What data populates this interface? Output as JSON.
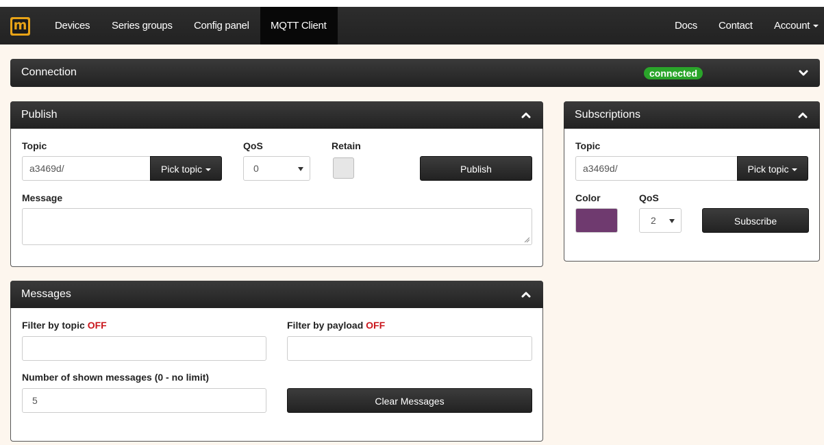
{
  "nav": {
    "logo_letter": "m",
    "items": [
      "Devices",
      "Series groups",
      "Config panel",
      "MQTT Client"
    ],
    "active": "MQTT Client",
    "right_items": [
      "Docs",
      "Contact",
      "Account"
    ]
  },
  "connection": {
    "title": "Connection",
    "status": "connected",
    "status_color": "#2aa52a"
  },
  "publish": {
    "title": "Publish",
    "topic_label": "Topic",
    "topic_value": "a3469d/",
    "pick_topic_label": "Pick topic",
    "qos_label": "QoS",
    "qos_value": "0",
    "retain_label": "Retain",
    "publish_button": "Publish",
    "message_label": "Message",
    "message_value": ""
  },
  "subscriptions": {
    "title": "Subscriptions",
    "topic_label": "Topic",
    "topic_value": "a3469d/",
    "pick_topic_label": "Pick topic",
    "color_label": "Color",
    "color_value": "#6f3a6f",
    "qos_label": "QoS",
    "qos_value": "2",
    "subscribe_button": "Subscribe"
  },
  "messages": {
    "title": "Messages",
    "filter_topic_label": "Filter by topic",
    "filter_topic_state": "OFF",
    "filter_payload_label": "Filter by payload",
    "filter_payload_state": "OFF",
    "limit_label": "Number of shown messages (0 - no limit)",
    "limit_value": "5",
    "clear_button": "Clear Messages"
  }
}
